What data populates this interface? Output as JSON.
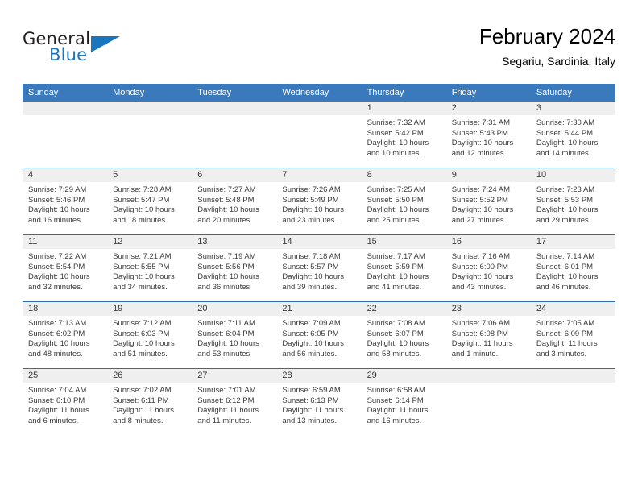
{
  "brand": {
    "name_top": "General",
    "name_bottom": "Blue",
    "accent_color": "#1b75bc"
  },
  "header": {
    "title": "February 2024",
    "subtitle": "Segariu, Sardinia, Italy"
  },
  "theme": {
    "header_row_bg": "#3b79bd",
    "row_divider": "#2f6da8",
    "daynum_band_bg": "#efefef",
    "text_color": "#3a3a3a"
  },
  "weekdays": [
    "Sunday",
    "Monday",
    "Tuesday",
    "Wednesday",
    "Thursday",
    "Friday",
    "Saturday"
  ],
  "weeks": [
    [
      {
        "day": "",
        "lines": []
      },
      {
        "day": "",
        "lines": []
      },
      {
        "day": "",
        "lines": []
      },
      {
        "day": "",
        "lines": []
      },
      {
        "day": "1",
        "lines": [
          "Sunrise: 7:32 AM",
          "Sunset: 5:42 PM",
          "Daylight: 10 hours",
          "and 10 minutes."
        ]
      },
      {
        "day": "2",
        "lines": [
          "Sunrise: 7:31 AM",
          "Sunset: 5:43 PM",
          "Daylight: 10 hours",
          "and 12 minutes."
        ]
      },
      {
        "day": "3",
        "lines": [
          "Sunrise: 7:30 AM",
          "Sunset: 5:44 PM",
          "Daylight: 10 hours",
          "and 14 minutes."
        ]
      }
    ],
    [
      {
        "day": "4",
        "lines": [
          "Sunrise: 7:29 AM",
          "Sunset: 5:46 PM",
          "Daylight: 10 hours",
          "and 16 minutes."
        ]
      },
      {
        "day": "5",
        "lines": [
          "Sunrise: 7:28 AM",
          "Sunset: 5:47 PM",
          "Daylight: 10 hours",
          "and 18 minutes."
        ]
      },
      {
        "day": "6",
        "lines": [
          "Sunrise: 7:27 AM",
          "Sunset: 5:48 PM",
          "Daylight: 10 hours",
          "and 20 minutes."
        ]
      },
      {
        "day": "7",
        "lines": [
          "Sunrise: 7:26 AM",
          "Sunset: 5:49 PM",
          "Daylight: 10 hours",
          "and 23 minutes."
        ]
      },
      {
        "day": "8",
        "lines": [
          "Sunrise: 7:25 AM",
          "Sunset: 5:50 PM",
          "Daylight: 10 hours",
          "and 25 minutes."
        ]
      },
      {
        "day": "9",
        "lines": [
          "Sunrise: 7:24 AM",
          "Sunset: 5:52 PM",
          "Daylight: 10 hours",
          "and 27 minutes."
        ]
      },
      {
        "day": "10",
        "lines": [
          "Sunrise: 7:23 AM",
          "Sunset: 5:53 PM",
          "Daylight: 10 hours",
          "and 29 minutes."
        ]
      }
    ],
    [
      {
        "day": "11",
        "lines": [
          "Sunrise: 7:22 AM",
          "Sunset: 5:54 PM",
          "Daylight: 10 hours",
          "and 32 minutes."
        ]
      },
      {
        "day": "12",
        "lines": [
          "Sunrise: 7:21 AM",
          "Sunset: 5:55 PM",
          "Daylight: 10 hours",
          "and 34 minutes."
        ]
      },
      {
        "day": "13",
        "lines": [
          "Sunrise: 7:19 AM",
          "Sunset: 5:56 PM",
          "Daylight: 10 hours",
          "and 36 minutes."
        ]
      },
      {
        "day": "14",
        "lines": [
          "Sunrise: 7:18 AM",
          "Sunset: 5:57 PM",
          "Daylight: 10 hours",
          "and 39 minutes."
        ]
      },
      {
        "day": "15",
        "lines": [
          "Sunrise: 7:17 AM",
          "Sunset: 5:59 PM",
          "Daylight: 10 hours",
          "and 41 minutes."
        ]
      },
      {
        "day": "16",
        "lines": [
          "Sunrise: 7:16 AM",
          "Sunset: 6:00 PM",
          "Daylight: 10 hours",
          "and 43 minutes."
        ]
      },
      {
        "day": "17",
        "lines": [
          "Sunrise: 7:14 AM",
          "Sunset: 6:01 PM",
          "Daylight: 10 hours",
          "and 46 minutes."
        ]
      }
    ],
    [
      {
        "day": "18",
        "lines": [
          "Sunrise: 7:13 AM",
          "Sunset: 6:02 PM",
          "Daylight: 10 hours",
          "and 48 minutes."
        ]
      },
      {
        "day": "19",
        "lines": [
          "Sunrise: 7:12 AM",
          "Sunset: 6:03 PM",
          "Daylight: 10 hours",
          "and 51 minutes."
        ]
      },
      {
        "day": "20",
        "lines": [
          "Sunrise: 7:11 AM",
          "Sunset: 6:04 PM",
          "Daylight: 10 hours",
          "and 53 minutes."
        ]
      },
      {
        "day": "21",
        "lines": [
          "Sunrise: 7:09 AM",
          "Sunset: 6:05 PM",
          "Daylight: 10 hours",
          "and 56 minutes."
        ]
      },
      {
        "day": "22",
        "lines": [
          "Sunrise: 7:08 AM",
          "Sunset: 6:07 PM",
          "Daylight: 10 hours",
          "and 58 minutes."
        ]
      },
      {
        "day": "23",
        "lines": [
          "Sunrise: 7:06 AM",
          "Sunset: 6:08 PM",
          "Daylight: 11 hours",
          "and 1 minute."
        ]
      },
      {
        "day": "24",
        "lines": [
          "Sunrise: 7:05 AM",
          "Sunset: 6:09 PM",
          "Daylight: 11 hours",
          "and 3 minutes."
        ]
      }
    ],
    [
      {
        "day": "25",
        "lines": [
          "Sunrise: 7:04 AM",
          "Sunset: 6:10 PM",
          "Daylight: 11 hours",
          "and 6 minutes."
        ]
      },
      {
        "day": "26",
        "lines": [
          "Sunrise: 7:02 AM",
          "Sunset: 6:11 PM",
          "Daylight: 11 hours",
          "and 8 minutes."
        ]
      },
      {
        "day": "27",
        "lines": [
          "Sunrise: 7:01 AM",
          "Sunset: 6:12 PM",
          "Daylight: 11 hours",
          "and 11 minutes."
        ]
      },
      {
        "day": "28",
        "lines": [
          "Sunrise: 6:59 AM",
          "Sunset: 6:13 PM",
          "Daylight: 11 hours",
          "and 13 minutes."
        ]
      },
      {
        "day": "29",
        "lines": [
          "Sunrise: 6:58 AM",
          "Sunset: 6:14 PM",
          "Daylight: 11 hours",
          "and 16 minutes."
        ]
      },
      {
        "day": "",
        "lines": []
      },
      {
        "day": "",
        "lines": []
      }
    ]
  ]
}
